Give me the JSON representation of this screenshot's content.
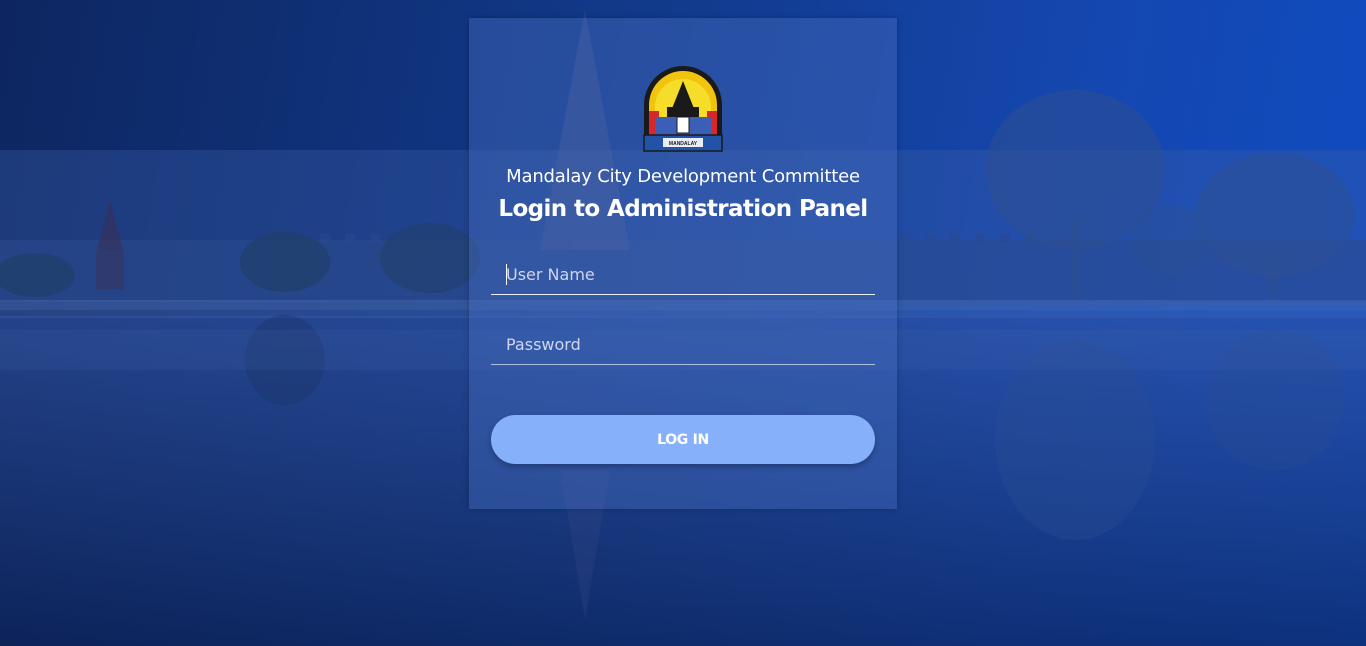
{
  "header": {
    "organization": "Mandalay City Development Committee",
    "title": "Login to Administration Panel"
  },
  "logo": {
    "icon": "mcdc-emblem-icon",
    "caption": "MANDALAY"
  },
  "form": {
    "username_placeholder": "User Name",
    "username_value": "",
    "password_placeholder": "Password",
    "password_value": "",
    "login_label": "LOG IN"
  },
  "colors": {
    "background": "#1240a0",
    "panel": "#4a6fbe",
    "button": "#86b1fa",
    "text": "#ffffff"
  }
}
